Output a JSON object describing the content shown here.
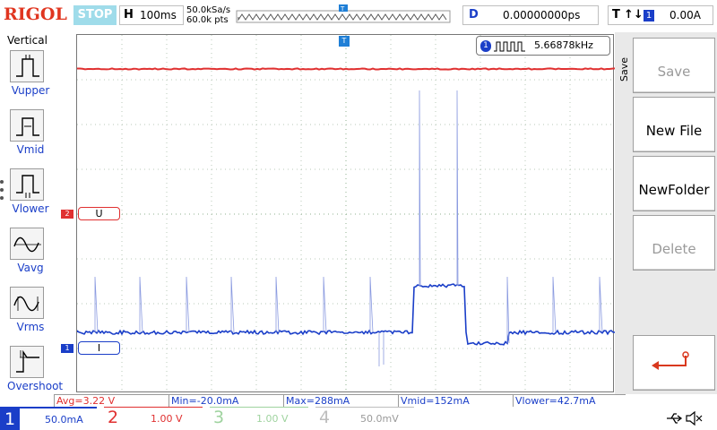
{
  "app": {
    "logo": "RIGOL",
    "run_state": "STOP"
  },
  "timebase": {
    "letter": "H",
    "scale": "100ms",
    "sample_rate": "50.0kSa/s",
    "points": "60.0k pts"
  },
  "delay": {
    "letter": "D",
    "value": "0.00000000ps"
  },
  "trigger": {
    "letter": "T",
    "edge_symbol": "↑↓",
    "source": "1",
    "level": "0.00A"
  },
  "left_menu": {
    "title": "Vertical",
    "items": [
      {
        "label": "Vupper",
        "icon": "vupper-icon"
      },
      {
        "label": "Vmid",
        "icon": "vmid-icon"
      },
      {
        "label": "Vlower",
        "icon": "vlower-icon"
      },
      {
        "label": "Vavg",
        "icon": "vavg-icon"
      },
      {
        "label": "Vrms",
        "icon": "vrms-icon"
      },
      {
        "label": "Overshoot",
        "icon": "overshoot-icon"
      }
    ]
  },
  "frequency_readout": {
    "channel": "1",
    "value": "5.66878kHz"
  },
  "markers": {
    "ch2": "2",
    "ch2_label": "U",
    "ch1": "1",
    "ch1_label": "I",
    "trigger_pos": "T",
    "trigger_level": "T"
  },
  "right_menu": {
    "title": "Save",
    "buttons": [
      {
        "label": "Save",
        "enabled": false
      },
      {
        "label": "New File",
        "enabled": true
      },
      {
        "label": "NewFolder",
        "enabled": true
      },
      {
        "label": "Delete",
        "enabled": false
      },
      {
        "label": "",
        "icon": "return-arrow-icon",
        "enabled": true
      }
    ]
  },
  "measurements": [
    {
      "text": "Avg=3.22 V",
      "color": "#e03030"
    },
    {
      "text": "Min=-20.0mA",
      "color": "#1a3ec8"
    },
    {
      "text": "Max=288mA",
      "color": "#1a3ec8"
    },
    {
      "text": "Vmid=152mA",
      "color": "#1a3ec8"
    },
    {
      "text": "Vlower=42.7mA",
      "color": "#1a3ec8"
    }
  ],
  "channels": [
    {
      "num": "1",
      "value": "50.0mA",
      "color": "#1a3ec8"
    },
    {
      "num": "2",
      "value": "1.00 V",
      "color": "#e03030"
    },
    {
      "num": "3",
      "value": "1.00 V",
      "color": "#9fd39f"
    },
    {
      "num": "4",
      "value": "50.0mV",
      "color": "#bdbdbd"
    }
  ],
  "status_icons": {
    "usb": "usb-icon",
    "sound": "mute-icon"
  },
  "colors": {
    "ch1": "#1a3ec8",
    "ch2": "#e03030",
    "trigger": "#1f7fd6",
    "accent": "#1a3ec8"
  }
}
